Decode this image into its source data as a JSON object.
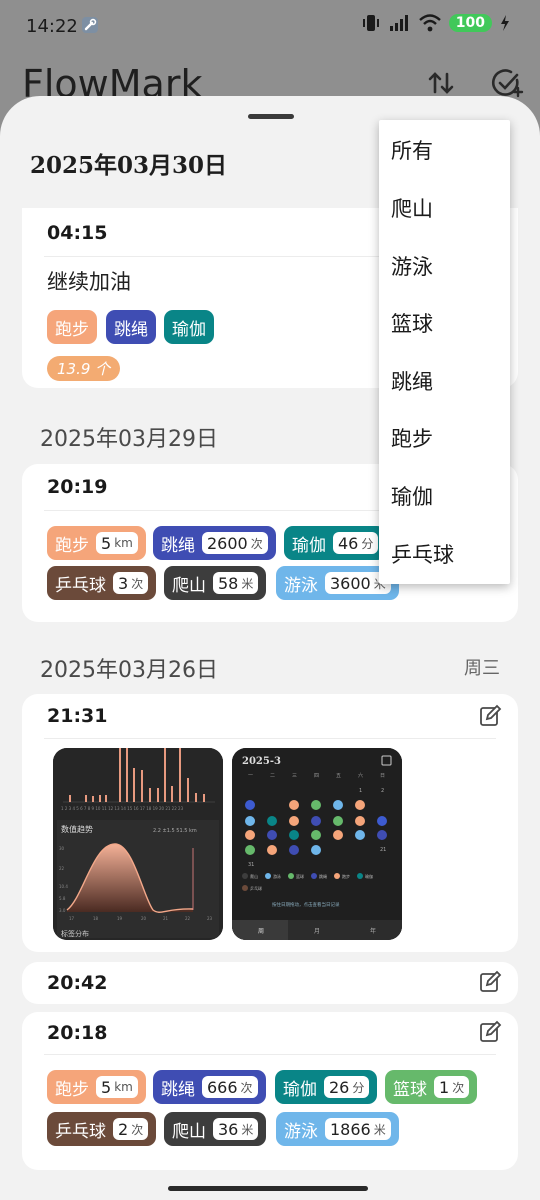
{
  "status": {
    "time": "14:22",
    "battery": "100"
  },
  "app": {
    "title": "FlowMark"
  },
  "colors": {
    "paobu": "#f5a57a",
    "tiaosheng": "#3f4db3",
    "yujia": "#098587",
    "pingpang": "#6b4a3a",
    "pashan": "#3d3d3d",
    "youyong": "#6fb6ea",
    "lanqiu": "#66b96b",
    "count_pill": "#f3ab72"
  },
  "dropdown": {
    "items": [
      "所有",
      "爬山",
      "游泳",
      "篮球",
      "跳绳",
      "跑步",
      "瑜伽",
      "乒乓球"
    ]
  },
  "days": [
    {
      "date": "2025年03月30日",
      "entries": [
        {
          "time": "04:15",
          "note": "继续加油",
          "tags": [
            "跑步",
            "跳绳",
            "瑜伽"
          ],
          "count": "13.9 个"
        }
      ]
    },
    {
      "date": "2025年03月29日",
      "entries": [
        {
          "time": "20:19",
          "tags": [
            {
              "name": "跑步",
              "value": "5",
              "unit": "km"
            },
            {
              "name": "跳绳",
              "value": "2600",
              "unit": "次"
            },
            {
              "name": "瑜伽",
              "value": "46",
              "unit": "分"
            },
            {
              "name": "乒乓球",
              "value": "3",
              "unit": "次"
            },
            {
              "name": "爬山",
              "value": "58",
              "unit": "米"
            },
            {
              "name": "游泳",
              "value": "3600",
              "unit": "米"
            }
          ]
        }
      ]
    },
    {
      "date": "2025年03月26日",
      "weekday": "周三",
      "entries": [
        {
          "time": "21:31",
          "thumb1": {
            "bar_axis": "1 2 3 4 5 6 7 8 9 10 11 12 13 14 15 16 17 18 19 20 21 22 23",
            "trend_title": "数值趋势",
            "trend_meta": "2.2 ±1.5  51.5 km",
            "trend_y": [
              "30",
              "22",
              "10.4",
              "5.8",
              "3.0"
            ],
            "trend_x": [
              "17",
              "18",
              "19",
              "20",
              "21",
              "22",
              "23"
            ],
            "bottom_label": "标签分布"
          },
          "thumb2": {
            "month": "2025-3",
            "weekdays": [
              "一",
              "二",
              "三",
              "四",
              "五",
              "六",
              "日"
            ],
            "legend": [
              "爬山",
              "游泳",
              "篮球",
              "跳绳",
              "跑步",
              "瑜伽",
              "乒乓球"
            ],
            "hint": "按住日期拖动，点击查看当日记录",
            "tabs": [
              "周",
              "月",
              "年"
            ]
          }
        },
        {
          "time": "20:42"
        },
        {
          "time": "20:18",
          "tags": [
            {
              "name": "跑步",
              "value": "5",
              "unit": "km"
            },
            {
              "name": "跳绳",
              "value": "666",
              "unit": "次"
            },
            {
              "name": "瑜伽",
              "value": "26",
              "unit": "分"
            },
            {
              "name": "篮球",
              "value": "1",
              "unit": "次"
            },
            {
              "name": "乒乓球",
              "value": "2",
              "unit": "次"
            },
            {
              "name": "爬山",
              "value": "36",
              "unit": "米"
            },
            {
              "name": "游泳",
              "value": "1866",
              "unit": "米"
            }
          ]
        }
      ]
    }
  ]
}
